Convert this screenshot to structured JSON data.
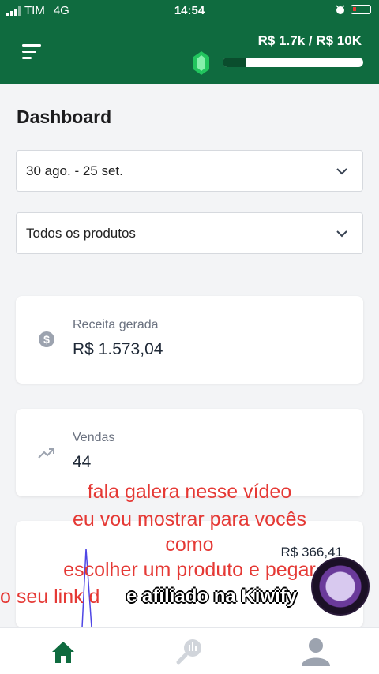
{
  "status_bar": {
    "carrier": "TIM",
    "network": "4G",
    "time": "14:54"
  },
  "header": {
    "revenue_progress": "R$ 1.7k / R$ 10K",
    "progress_fraction": 0.17
  },
  "page": {
    "title": "Dashboard"
  },
  "filters": {
    "date_range": "30 ago. - 25 set.",
    "product": "Todos os produtos"
  },
  "cards": [
    {
      "label": "Receita gerada",
      "value": "R$ 1.573,04",
      "icon": "dollar-circle-icon"
    },
    {
      "label": "Vendas",
      "value": "44",
      "icon": "trending-up-icon"
    },
    {
      "value": "R$ 366,41"
    }
  ],
  "captions": {
    "line1": "fala galera nesse vídeo",
    "line2": "eu vou mostrar para vocês",
    "line3": "como",
    "line4": "escolher um produto e pegar",
    "line5": "o seu link d",
    "overlay": "e afiliado na Kiwify"
  },
  "colors": {
    "brand": "#0f6b3f",
    "caption": "#e53935"
  },
  "nav": [
    "home-icon",
    "analytics-icon",
    "profile-icon"
  ]
}
